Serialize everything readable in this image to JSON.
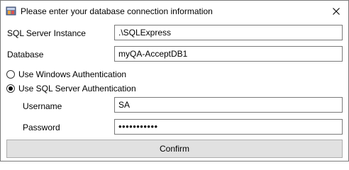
{
  "window": {
    "title": "Please enter your database connection information",
    "close_glyph": "✕",
    "icon": "database-app-icon"
  },
  "form": {
    "server_label": "SQL Server Instance",
    "server_value": ".\\SQLExpress",
    "database_label": "Database",
    "database_value": "myQA-AcceptDB1",
    "auth_windows_label": "Use Windows Authentication",
    "auth_windows_selected": false,
    "auth_sql_label": "Use SQL Server Authentication",
    "auth_sql_selected": true,
    "username_label": "Username",
    "username_value": "SA",
    "password_label": "Password",
    "password_value": "•••••••••••"
  },
  "actions": {
    "confirm_label": "Confirm"
  }
}
